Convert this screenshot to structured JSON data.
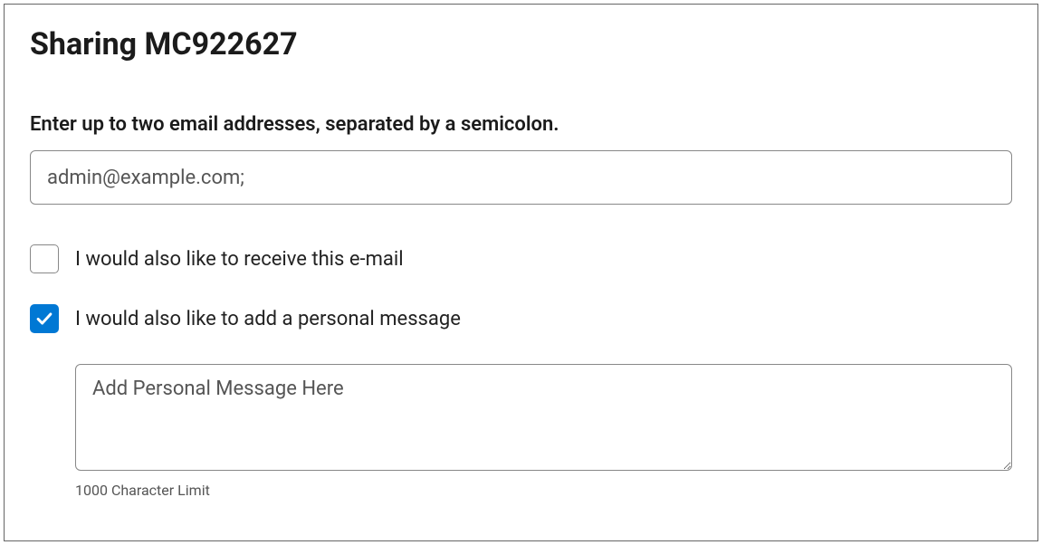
{
  "title": "Sharing MC922627",
  "instruction": "Enter up to two email addresses, separated by a semicolon.",
  "email_input": {
    "value": "admin@example.com;"
  },
  "checkbox_receive": {
    "label": "I would also like to receive this e-mail",
    "checked": false
  },
  "checkbox_personal": {
    "label": "I would also like to add a personal message",
    "checked": true
  },
  "message": {
    "placeholder": "Add Personal Message Here",
    "char_limit": "1000 Character Limit"
  }
}
